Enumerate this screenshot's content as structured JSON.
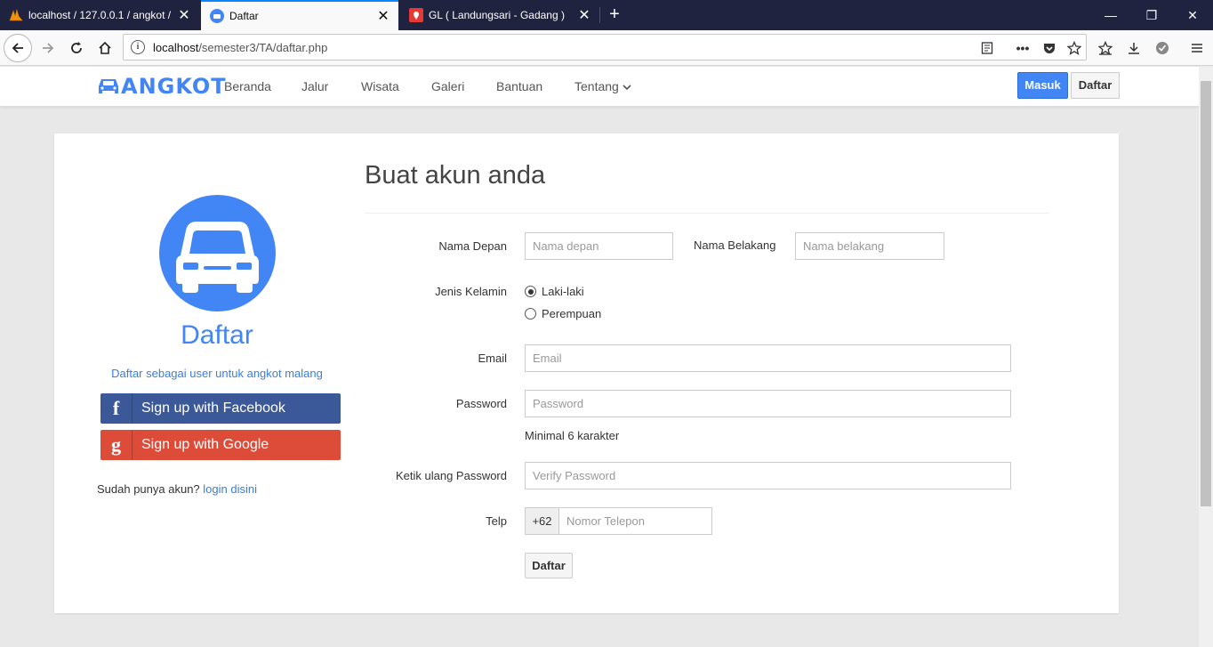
{
  "browser": {
    "tabs": [
      {
        "title": "localhost / 127.0.0.1 / angkot /",
        "active": false
      },
      {
        "title": "Daftar",
        "active": true
      },
      {
        "title": "GL ( Landungsari - Gadang )",
        "active": false
      }
    ],
    "url": {
      "host": "localhost",
      "path": "/semester3/TA/daftar.php"
    }
  },
  "site": {
    "brand": "ANGKOT",
    "menu": [
      "Beranda",
      "Jalur",
      "Wisata",
      "Galeri",
      "Bantuan",
      "Tentang"
    ],
    "login_label": "Masuk",
    "register_label": "Daftar"
  },
  "left_panel": {
    "title": "Daftar",
    "subtitle": "Daftar sebagai user untuk angkot malang",
    "facebook_label": "Sign up with Facebook",
    "google_label": "Sign up with Google",
    "have_account": "Sudah punya akun?",
    "login_link": "login disini"
  },
  "form": {
    "title": "Buat akun anda",
    "first_name_label": "Nama Depan",
    "first_name_placeholder": "Nama depan",
    "last_name_label": "Nama Belakang",
    "last_name_placeholder": "Nama belakang",
    "gender_label": "Jenis Kelamin",
    "gender_options": [
      {
        "label": "Laki-laki",
        "checked": true
      },
      {
        "label": "Perempuan",
        "checked": false
      }
    ],
    "email_label": "Email",
    "email_placeholder": "Email",
    "password_label": "Password",
    "password_placeholder": "Password",
    "password_help": "Minimal 6 karakter",
    "verify_label": "Ketik ulang Password",
    "verify_placeholder": "Verify Password",
    "phone_label": "Telp",
    "phone_prefix": "+62",
    "phone_placeholder": "Nomor Telepon",
    "submit_label": "Daftar"
  },
  "colors": {
    "primary": "#4285f4",
    "facebook": "#3b5998",
    "google": "#dd4b39",
    "tabstrip": "#202340"
  }
}
